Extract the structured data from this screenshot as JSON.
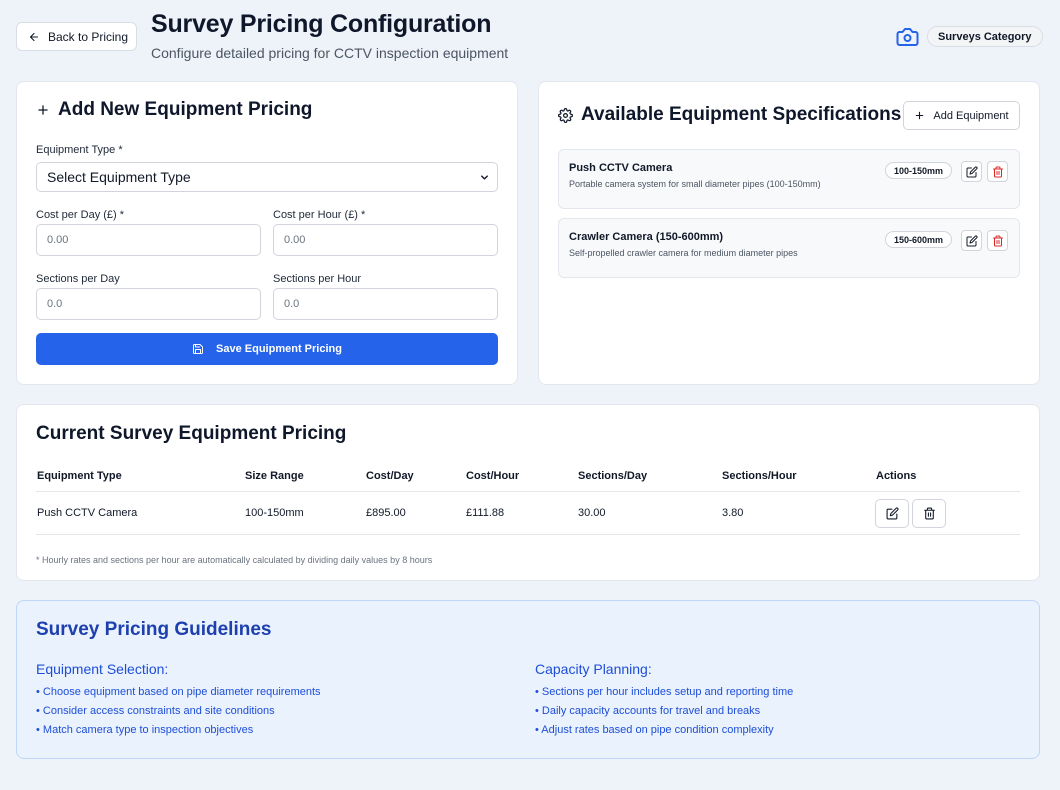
{
  "header": {
    "back_label": "Back to Pricing",
    "title": "Survey Pricing Configuration",
    "subtitle": "Configure detailed pricing for CCTV inspection equipment",
    "category_badge": "Surveys Category"
  },
  "add_form": {
    "title": "Add New Equipment Pricing",
    "equipment_type_label": "Equipment Type *",
    "equipment_type_value": "Select Equipment Type",
    "cost_per_day_label": "Cost per Day (£) *",
    "cost_per_day_placeholder": "0.00",
    "cost_per_hour_label": "Cost per Hour (£) *",
    "cost_per_hour_placeholder": "0.00",
    "sections_per_day_label": "Sections per Day",
    "sections_per_day_placeholder": "0.0",
    "sections_per_hour_label": "Sections per Hour",
    "sections_per_hour_placeholder": "0.0",
    "save_label": "Save Equipment Pricing"
  },
  "specs": {
    "title": "Available Equipment Specifications",
    "add_label": "Add Equipment",
    "items": [
      {
        "name": "Push CCTV Camera",
        "description": "Portable camera system for small diameter pipes (100-150mm)",
        "size": "100-150mm"
      },
      {
        "name": "Crawler Camera (150-600mm)",
        "description": "Self-propelled crawler camera for medium diameter pipes",
        "size": "150-600mm"
      }
    ]
  },
  "pricing_table": {
    "title": "Current Survey Equipment Pricing",
    "columns": [
      "Equipment Type",
      "Size Range",
      "Cost/Day",
      "Cost/Hour",
      "Sections/Day",
      "Sections/Hour",
      "Actions"
    ],
    "rows": [
      {
        "equipment_type": "Push CCTV Camera",
        "size_range": "100-150mm",
        "cost_day": "£895.00",
        "cost_hour": "£111.88",
        "sections_day": "30.00",
        "sections_hour": "3.80"
      }
    ],
    "footnote": "* Hourly rates and sections per hour are automatically calculated by dividing daily values by 8 hours"
  },
  "guidelines": {
    "title": "Survey Pricing Guidelines",
    "equipment_heading": "Equipment Selection:",
    "equipment_items": [
      "• Choose equipment based on pipe diameter requirements",
      "• Consider access constraints and site conditions",
      "• Match camera type to inspection objectives"
    ],
    "capacity_heading": "Capacity Planning:",
    "capacity_items": [
      "• Sections per hour includes setup and reporting time",
      "• Daily capacity accounts for travel and breaks",
      "• Adjust rates based on pipe condition complexity"
    ]
  },
  "colors": {
    "primary": "#2563eb",
    "danger": "#dc2626",
    "guide_text": "#1d4ed8",
    "background": "#eef3f9"
  },
  "icons": [
    "arrow-left-icon",
    "camera-icon",
    "plus-icon",
    "chevron-down-icon",
    "save-icon",
    "gear-icon",
    "edit-icon",
    "trash-icon"
  ]
}
